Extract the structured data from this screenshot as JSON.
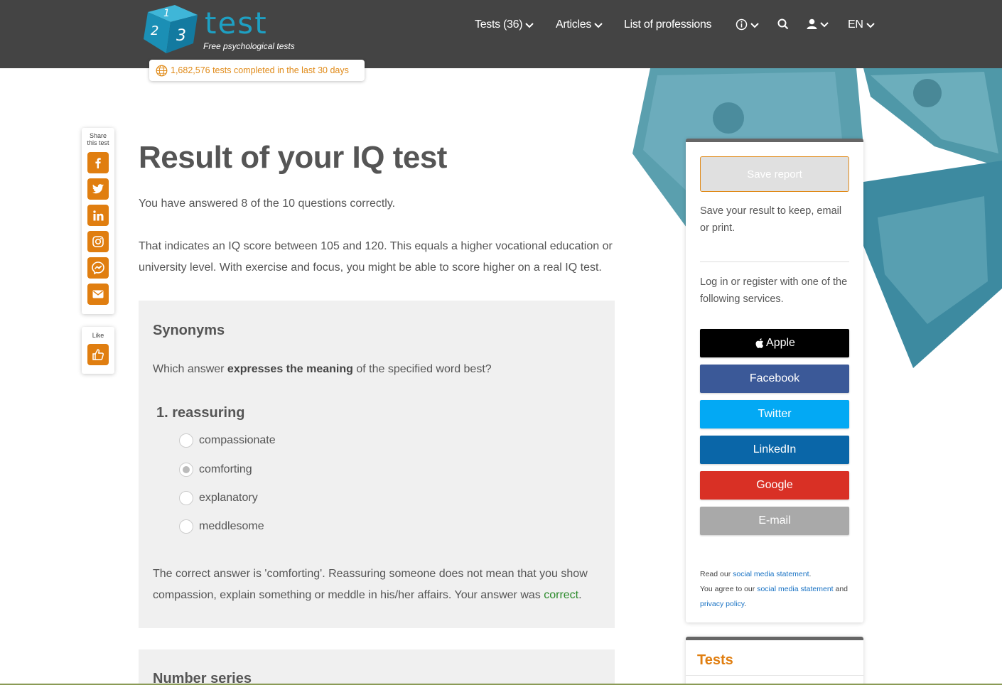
{
  "logo": {
    "word": "test",
    "tagline": "Free psychological tests"
  },
  "nav": {
    "tests": "Tests (36)",
    "articles": "Articles",
    "professions": "List of professions",
    "language": "EN"
  },
  "counter": "1,682,576 tests completed in the last 30 days",
  "share": {
    "label_line1": "Share",
    "label_line2": "this test",
    "like": "Like"
  },
  "main": {
    "title": "Result of your IQ test",
    "summary": "You have answered 8 of the 10 questions correctly.",
    "score_text": "That indicates an IQ score between 105 and 120. This equals a higher vocational education or university level. With exercise and focus, you might be able to score higher on a real IQ test."
  },
  "question_section": {
    "heading": "Synonyms",
    "prompt_before": "Which answer ",
    "prompt_bold": "expresses the meaning",
    "prompt_after": " of the specified word best?",
    "question": "1. reassuring",
    "options": [
      "compassionate",
      "comforting",
      "explanatory",
      "meddlesome"
    ],
    "selected_option": "comforting",
    "explanation": "The correct answer is 'comforting'. Reassuring someone does not mean that you show compassion, explain something or meddle in his/her affairs. Your answer was ",
    "result_word": "correct",
    "result_suffix": "."
  },
  "next_section": {
    "heading": "Number series"
  },
  "panel": {
    "save_button": "Save report",
    "save_text": "Save your result to keep, email or print.",
    "login_text": "Log in or register with one of the following services.",
    "services": [
      {
        "label": "Apple",
        "color": "#000000"
      },
      {
        "label": "Facebook",
        "color": "#3b5998"
      },
      {
        "label": "Twitter",
        "color": "#03a9f4"
      },
      {
        "label": "LinkedIn",
        "color": "#0a66a8"
      },
      {
        "label": "Google",
        "color": "#d93025"
      },
      {
        "label": "E-mail",
        "color": "#a9a9a9"
      }
    ],
    "read_prefix": "Read our ",
    "social_link": "social media statement",
    "read_suffix": ".",
    "agree_prefix": "You agree to our ",
    "agree_middle": " and",
    "privacy_link": "privacy policy",
    "privacy_suffix": "."
  },
  "tests_panel": {
    "title": "Tests"
  },
  "colors": {
    "header": "#444444",
    "accent": "#e07e10",
    "brand_blue": "#1ea0c3"
  }
}
